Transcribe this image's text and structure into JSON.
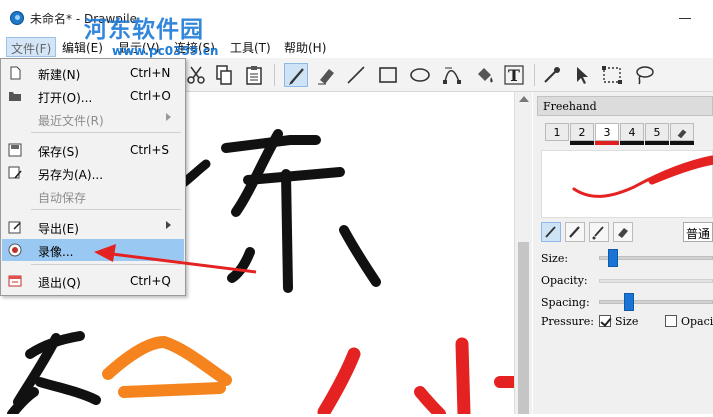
{
  "window": {
    "title": "未命名* - Drawpile"
  },
  "watermark": {
    "text": "河东软件园",
    "url": "www.pc0359.cn"
  },
  "menubar": {
    "items": [
      "文件(F)",
      "编辑(E)",
      "显示(V)",
      "连接(S)",
      "工具(T)",
      "帮助(H)"
    ]
  },
  "file_menu": {
    "items": [
      {
        "label": "新建(N)",
        "shortcut": "Ctrl+N",
        "icon": "new-file-icon",
        "enabled": true
      },
      {
        "label": "打开(O)...",
        "shortcut": "Ctrl+O",
        "icon": "folder-open-icon",
        "enabled": true
      },
      {
        "label": "最近文件(R)",
        "shortcut": "",
        "icon": "",
        "enabled": false,
        "submenu": true
      },
      {
        "label": "保存(S)",
        "shortcut": "Ctrl+S",
        "icon": "save-icon",
        "enabled": true
      },
      {
        "label": "另存为(A)...",
        "shortcut": "",
        "icon": "save-as-icon",
        "enabled": true
      },
      {
        "label": "自动保存",
        "shortcut": "",
        "icon": "",
        "enabled": false
      },
      {
        "label": "导出(E)",
        "shortcut": "",
        "icon": "export-icon",
        "enabled": true,
        "submenu": true
      },
      {
        "label": "录像...",
        "shortcut": "",
        "icon": "record-icon",
        "enabled": true,
        "highlighted": true
      },
      {
        "label": "退出(Q)",
        "shortcut": "Ctrl+Q",
        "icon": "exit-icon",
        "enabled": true
      }
    ]
  },
  "toolbar": {
    "tools": [
      "cut-icon",
      "copy-icon",
      "paste-icon",
      "freehand-brush-icon",
      "eraser-icon",
      "line-icon",
      "rectangle-icon",
      "ellipse-icon",
      "bezier-icon",
      "fill-bucket-icon",
      "text-icon",
      "color-picker-icon",
      "select-arrow-icon",
      "rect-select-icon",
      "lasso-icon"
    ],
    "active_tool": "freehand-brush-icon"
  },
  "dock": {
    "title": "Freehand",
    "preset_tabs": [
      "1",
      "2",
      "3",
      "4",
      "5"
    ],
    "selected_preset": "3",
    "blend_mode": "普通",
    "properties": {
      "size_label": "Size:",
      "opacity_label": "Opacity:",
      "spacing_label": "Spacing:",
      "pressure_label": "Pressure:",
      "pressure_size_label": "Size",
      "pressure_opacity_label": "Opaci"
    },
    "size_level": 0.07,
    "spacing_level": 0.13,
    "pressure_size_checked": true,
    "pressure_opacity_checked": false
  },
  "colors": {
    "accent": "#1a74d6",
    "highlight": "#99c9f3",
    "stroke_red": "#e52222",
    "stroke_orange": "#f5841f",
    "arrow_red": "#e52222"
  }
}
